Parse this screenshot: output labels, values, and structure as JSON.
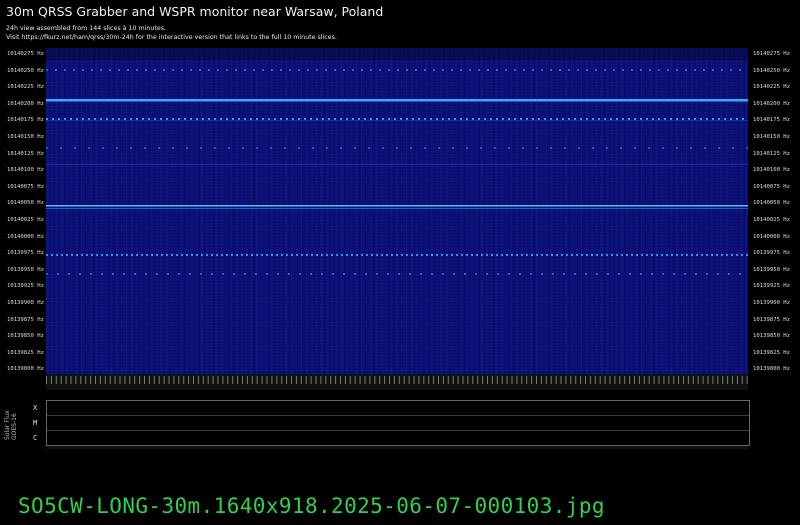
{
  "header": {
    "title": "30m QRSS Grabber and WSPR monitor near Warsaw, Poland",
    "line1": "24h view assembled from 144 slices à 10 minutes.",
    "line2": "Visit https://fkurz.net/ham/qrss/30m-24h for the interactive version that links to the full 10 minute slices."
  },
  "axis": {
    "labels": [
      "10140275 Hz",
      "10140250 Hz",
      "10140225 Hz",
      "10140200 Hz",
      "10140175 Hz",
      "10140150 Hz",
      "10140125 Hz",
      "10140100 Hz",
      "10140075 Hz",
      "10140050 Hz",
      "10140025 Hz",
      "10140000 Hz",
      "10139975 Hz",
      "10139950 Hz",
      "10139925 Hz",
      "10139900 Hz",
      "10139875 Hz",
      "10139850 Hz",
      "10139825 Hz",
      "10139800 Hz"
    ]
  },
  "flux": {
    "vertical_label_1": "Solar Flux",
    "vertical_label_2": "GOES-16",
    "classes": [
      "X",
      "M",
      "C"
    ]
  },
  "footer": {
    "filename": "SO5CW-LONG-30m.1640x918.2025-06-07-000103.jpg"
  },
  "colors": {
    "background": "#000000",
    "waterfall": "#0a0f6e",
    "signal": "#38a8ff",
    "filename": "#2fd04a"
  }
}
